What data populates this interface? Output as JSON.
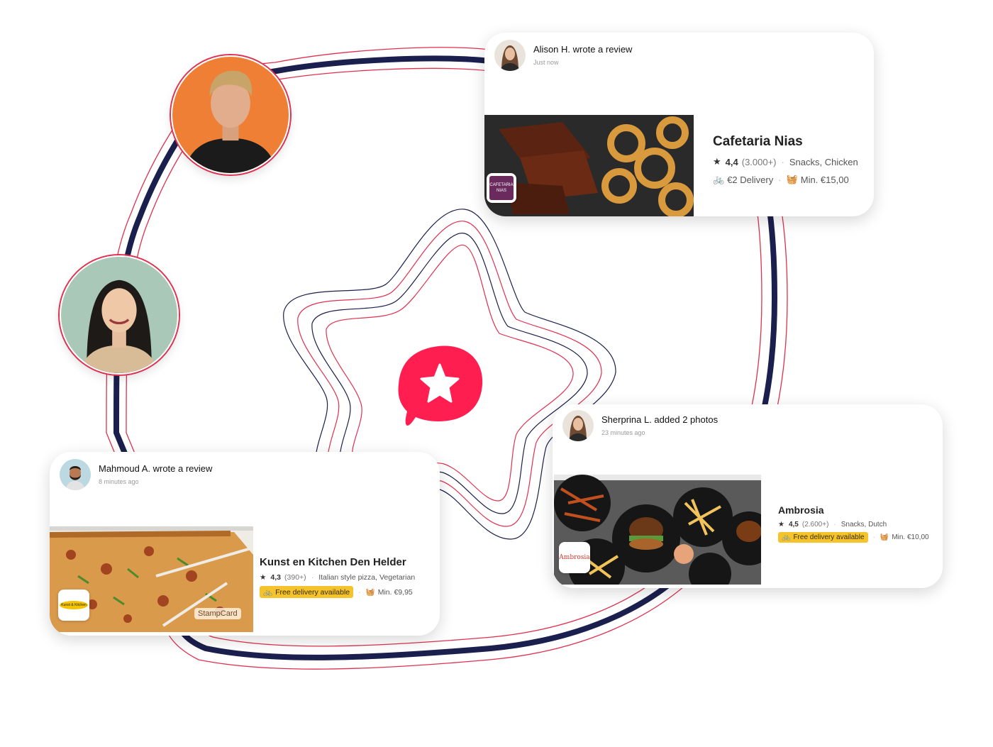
{
  "colors": {
    "brand": "#ff1e4f",
    "navy": "#1a1f4d",
    "badge": "#f5c32c"
  },
  "cards": [
    {
      "author": "Alison H. wrote a review",
      "time": "Just now",
      "restaurant": "Cafetaria Nias",
      "rating": "4,4",
      "reviews": "(3.000+)",
      "categories": "Snacks, Chicken",
      "delivery": "€2 Delivery",
      "minimum": "Min. €15,00",
      "logo_text": "CAFETARIA NIAS"
    },
    {
      "author": "Sherprina L. added 2 photos",
      "time": "23 minutes ago",
      "restaurant": "Ambrosia",
      "rating": "4,5",
      "reviews": "(2.600+)",
      "categories": "Snacks, Dutch",
      "delivery": "Free delivery available",
      "minimum": "Min. €10,00",
      "logo_text": "Ambrosia"
    },
    {
      "author": "Mahmoud A. wrote a review",
      "time": "8 minutes ago",
      "restaurant": "Kunst en Kitchen Den Helder",
      "rating": "4,3",
      "reviews": "(390+)",
      "categories": "Italian style pizza, Vegetarian",
      "delivery": "Free delivery available",
      "minimum": "Min. €9,95",
      "logo_text": "Kunst & Kitchen",
      "stamp": "StampCard"
    }
  ],
  "icons": {
    "star": "star-icon",
    "bike": "bike-icon",
    "basket": "basket-icon",
    "center": "review-star-bubble-icon"
  }
}
